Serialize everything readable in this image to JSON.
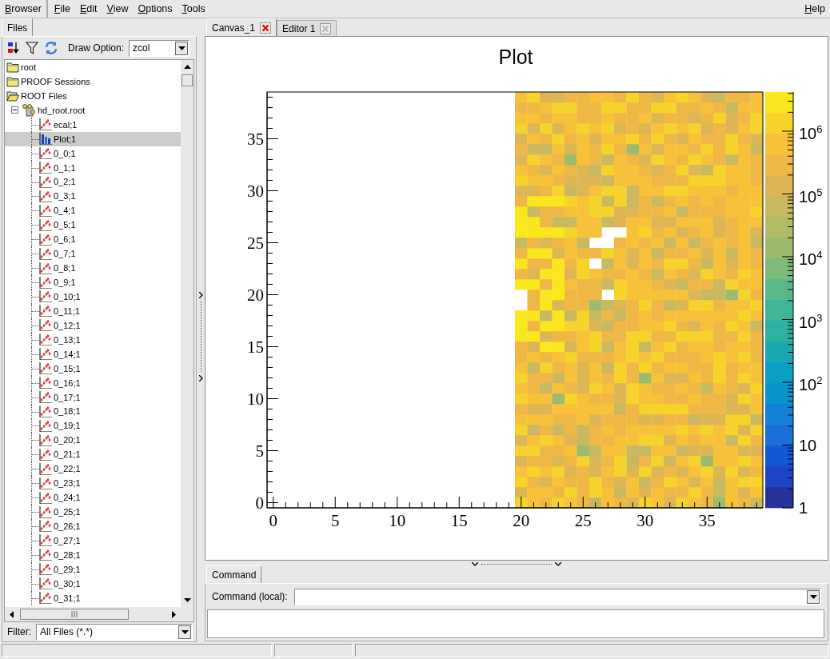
{
  "menu_bar": {
    "browser_menu": "Browser",
    "items": [
      "File",
      "Edit",
      "View",
      "Options",
      "Tools"
    ],
    "help": "Help"
  },
  "left_panel": {
    "tabs": [
      {
        "label": "Files",
        "selected": true
      }
    ],
    "draw_option": {
      "label": "Draw Option:",
      "value": "zcol"
    },
    "tree": [
      {
        "label": "root",
        "kind": "folder",
        "expanded": false,
        "selected": false
      },
      {
        "label": "PROOF Sessions",
        "kind": "folder",
        "expanded": false,
        "selected": false
      },
      {
        "label": "ROOT Files",
        "kind": "folder",
        "expanded": true,
        "selected": false,
        "children": [
          {
            "label": "hd_root.root",
            "kind": "file",
            "expanded": true,
            "selected": false,
            "children": [
              {
                "label": "ecal;1",
                "kind": "histogram",
                "selected": false
              },
              {
                "label": "Plot;1",
                "kind": "histogram2d",
                "selected": true
              },
              {
                "label": "0_0;1",
                "kind": "histogram",
                "selected": false
              },
              {
                "label": "0_1;1",
                "kind": "histogram",
                "selected": false
              },
              {
                "label": "0_2;1",
                "kind": "histogram",
                "selected": false
              },
              {
                "label": "0_3;1",
                "kind": "histogram",
                "selected": false
              },
              {
                "label": "0_4;1",
                "kind": "histogram",
                "selected": false
              },
              {
                "label": "0_5;1",
                "kind": "histogram",
                "selected": false
              },
              {
                "label": "0_6;1",
                "kind": "histogram",
                "selected": false
              },
              {
                "label": "0_7;1",
                "kind": "histogram",
                "selected": false
              },
              {
                "label": "0_8;1",
                "kind": "histogram",
                "selected": false
              },
              {
                "label": "0_9;1",
                "kind": "histogram",
                "selected": false
              },
              {
                "label": "0_10;1",
                "kind": "histogram",
                "selected": false
              },
              {
                "label": "0_11;1",
                "kind": "histogram",
                "selected": false
              },
              {
                "label": "0_12;1",
                "kind": "histogram",
                "selected": false
              },
              {
                "label": "0_13;1",
                "kind": "histogram",
                "selected": false
              },
              {
                "label": "0_14;1",
                "kind": "histogram",
                "selected": false
              },
              {
                "label": "0_15;1",
                "kind": "histogram",
                "selected": false
              },
              {
                "label": "0_16;1",
                "kind": "histogram",
                "selected": false
              },
              {
                "label": "0_17;1",
                "kind": "histogram",
                "selected": false
              },
              {
                "label": "0_18;1",
                "kind": "histogram",
                "selected": false
              },
              {
                "label": "0_19;1",
                "kind": "histogram",
                "selected": false
              },
              {
                "label": "0_20;1",
                "kind": "histogram",
                "selected": false
              },
              {
                "label": "0_21;1",
                "kind": "histogram",
                "selected": false
              },
              {
                "label": "0_22;1",
                "kind": "histogram",
                "selected": false
              },
              {
                "label": "0_23;1",
                "kind": "histogram",
                "selected": false
              },
              {
                "label": "0_24;1",
                "kind": "histogram",
                "selected": false
              },
              {
                "label": "0_25;1",
                "kind": "histogram",
                "selected": false
              },
              {
                "label": "0_26;1",
                "kind": "histogram",
                "selected": false
              },
              {
                "label": "0_27;1",
                "kind": "histogram",
                "selected": false
              },
              {
                "label": "0_28;1",
                "kind": "histogram",
                "selected": false
              },
              {
                "label": "0_29;1",
                "kind": "histogram",
                "selected": false
              },
              {
                "label": "0_30;1",
                "kind": "histogram",
                "selected": false
              },
              {
                "label": "0_31;1",
                "kind": "histogram",
                "selected": false
              }
            ]
          }
        ]
      }
    ],
    "filter": {
      "label": "Filter:",
      "value": "All Files (*.*)"
    }
  },
  "canvas_tabs": [
    {
      "label": "Canvas_1",
      "selected": true
    },
    {
      "label": "Editor 1",
      "selected": false
    }
  ],
  "plot": {
    "title": "Plot",
    "x_ticks": [
      "0",
      "5",
      "10",
      "15",
      "20",
      "25",
      "30",
      "35"
    ],
    "y_ticks": [
      "35",
      "30",
      "25",
      "20",
      "15",
      "10",
      "5",
      "0"
    ],
    "z_ticks": [
      "10$^{6}$",
      "10$^{5}$",
      "10$^{4}$",
      "10$^{3}$",
      "10$^{2}$",
      "10",
      "1"
    ]
  },
  "command_panel": {
    "tabs": [
      {
        "label": "Command",
        "selected": true
      }
    ],
    "label": "Command (local):"
  }
}
